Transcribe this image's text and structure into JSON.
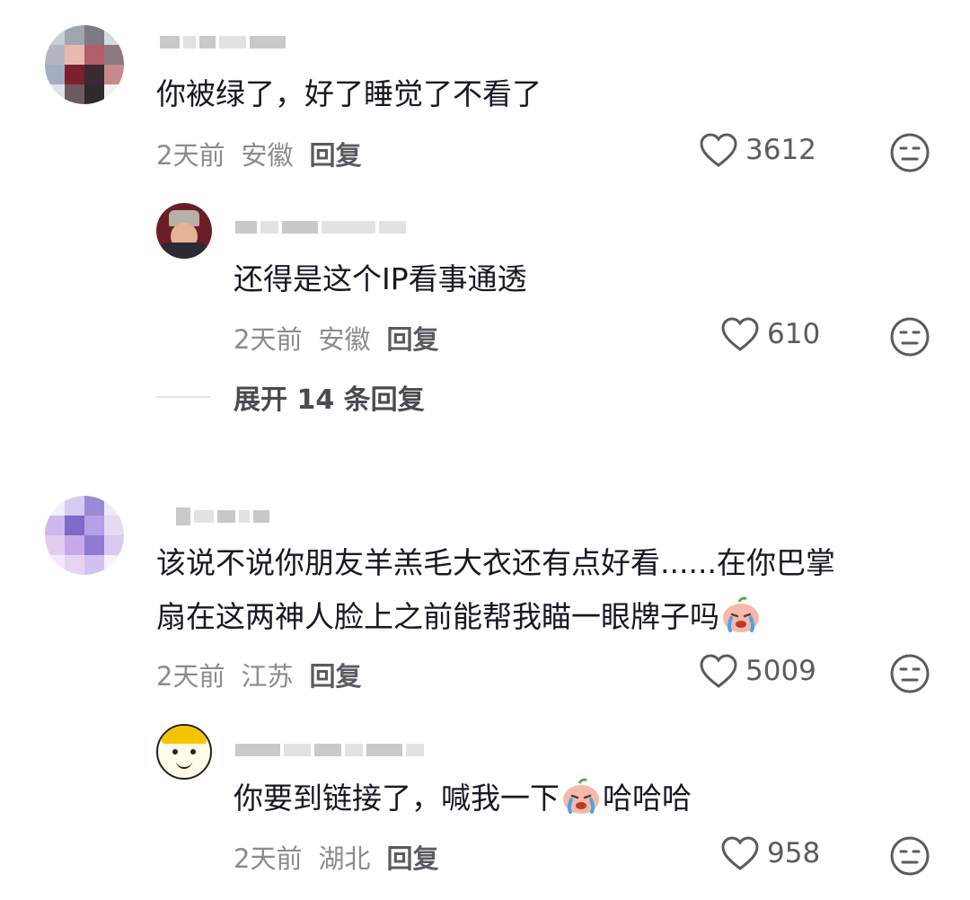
{
  "comments": [
    {
      "text": "你被绿了，好了睡觉了不看了",
      "time": "2天前",
      "location": "安徽",
      "reply_label": "回复",
      "likes": "3612",
      "replies": [
        {
          "text": "还得是这个IP看事通透",
          "time": "2天前",
          "location": "安徽",
          "reply_label": "回复",
          "likes": "610"
        }
      ],
      "expand_label": "展开 14 条回复"
    },
    {
      "text_line1": "该说不说你朋友羊羔毛大衣还有点好看......在你巴掌",
      "text_line2": "扇在这两神人脸上之前能帮我瞄一眼牌子吗",
      "time": "2天前",
      "location": "江苏",
      "reply_label": "回复",
      "likes": "5009",
      "replies": [
        {
          "text_before": "你要到链接了，喊我一下",
          "text_after": "哈哈哈",
          "time": "2天前",
          "location": "湖北",
          "reply_label": "回复",
          "likes": "958"
        }
      ]
    }
  ],
  "icons": {
    "like": "heart-outline-icon",
    "dislike": "meh-face-icon",
    "emoji": "crying-emoji-icon"
  },
  "colors": {
    "text_primary": "#161823",
    "text_secondary": "#8a8b91",
    "icon": "#5a5b61"
  }
}
